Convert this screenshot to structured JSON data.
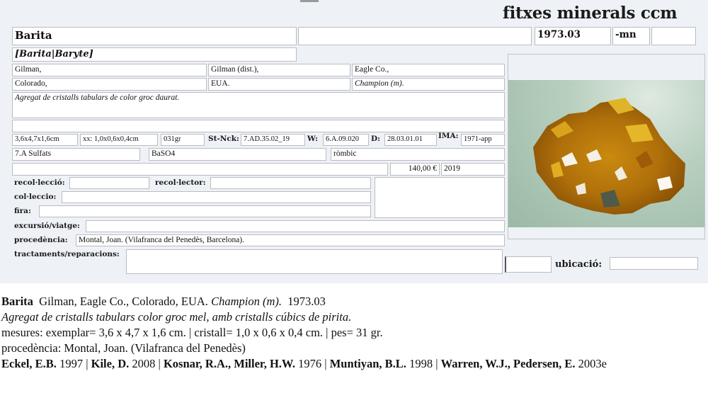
{
  "brand": "fitxes minerals ccm",
  "header": {
    "mineral_name": "Barita",
    "blank_field": "",
    "date_code": "1973.03",
    "suffix": "-mn",
    "extra": ""
  },
  "synonyms": "[Barita|Baryte]",
  "locality": {
    "row1": [
      "Gilman,",
      "Gilman (dist.),",
      "Eagle Co.,"
    ],
    "row2": [
      "Colorado,",
      "EUA.",
      "Champion (m)."
    ]
  },
  "description": "Agregat de cristalls tabulars de color groc daurat.",
  "notes_line": "",
  "measures": {
    "specimen": "3,6x4,7x1,6cm",
    "crystal": "xx: 1,0x0,6x0,4cm",
    "weight": "031gr",
    "strunz_label": "St-Nck:",
    "strunz": "7.AD.35.02_19",
    "w_label": "W:",
    "w": "6.A.09.020",
    "d_label": "D:",
    "d": "28.03.01.01",
    "ima_label": "IMA:",
    "ima": "1971-app"
  },
  "classification": {
    "class": "7.A Sulfats",
    "formula": "BaSO4",
    "system": "ròmbic"
  },
  "price_row": {
    "blank": "",
    "price": "140,00 €",
    "year": "2019"
  },
  "fields": {
    "recoleccio_label": "recol·lecció:",
    "recoleccio": "",
    "recolector_label": "recol·lector:",
    "recolector": "",
    "colleccio_label": "col·leccio:",
    "colleccio": "",
    "fira_label": "fira:",
    "fira": "",
    "excursio_label": "excursió/viatge:",
    "excursio": "",
    "procedencia_label": "procedència:",
    "procedencia": "Montal, Joan. (Vilafranca del Penedès, Barcelona).",
    "tractaments_label": "tractaments/reparacions:",
    "tractaments": "",
    "small_box": "",
    "ubicacio_label": "ubicació:",
    "ubicacio": ""
  },
  "photo": {
    "alt": "baryte-specimen-photo",
    "subject": "golden-yellow tabular baryte crystal aggregate"
  },
  "summary": {
    "name": "Barita",
    "locality": "Gilman, Eagle Co., Colorado, EUA.",
    "mine": "Champion (m).",
    "code": "1973.03",
    "description": "Agregat de cristalls tabulars color groc mel, amb cristalls cúbics de pirita.",
    "measures": "mesures: exemplar=  3,6 x 4,7 x 1,6 cm. | cristall=  1,0 x 0,6 x 0,4 cm. | pes= 31 gr.",
    "provenance": "procedència: Montal, Joan. (Vilafranca del Penedès)",
    "references": [
      {
        "author": "Eckel, E.B.",
        "year": "1997"
      },
      {
        "author": "Kile, D.",
        "year": "2008"
      },
      {
        "author": "Kosnar, R.A., Miller, H.W.",
        "year": "1976"
      },
      {
        "author": "Muntiyan, B.L.",
        "year": "1998"
      },
      {
        "author": "Warren, W.J., Pedersen, E.",
        "year": "2003e"
      }
    ]
  }
}
